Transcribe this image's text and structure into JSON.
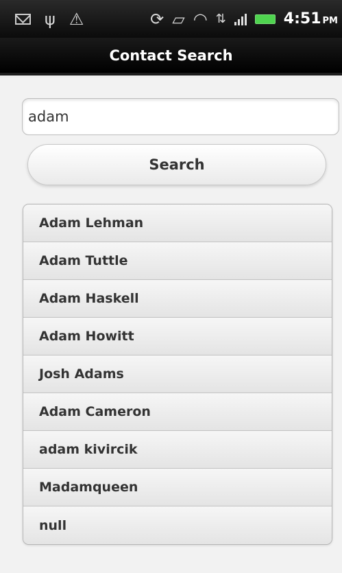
{
  "status_bar": {
    "time": "4:51",
    "ampm": "PM",
    "icons": [
      "mail-icon",
      "usb-icon",
      "warning-icon",
      "sync-icon",
      "vibrate-icon",
      "wifi-icon",
      "hspa-plus-icon",
      "signal-icon",
      "battery-icon"
    ]
  },
  "header": {
    "title": "Contact Search"
  },
  "search": {
    "value": "adam",
    "button_label": "Search"
  },
  "results": [
    {
      "name": "Adam Lehman"
    },
    {
      "name": "Adam Tuttle"
    },
    {
      "name": "Adam Haskell"
    },
    {
      "name": "Adam Howitt"
    },
    {
      "name": "Josh Adams"
    },
    {
      "name": "Adam Cameron"
    },
    {
      "name": "adam kivircik"
    },
    {
      "name": "Madamqueen"
    },
    {
      "name": "null"
    }
  ]
}
